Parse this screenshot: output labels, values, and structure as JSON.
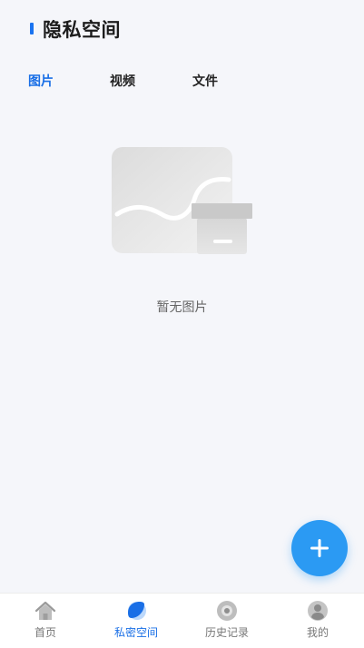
{
  "header": {
    "title": "隐私空间"
  },
  "tabs": [
    {
      "label": "图片",
      "active": true
    },
    {
      "label": "视频",
      "active": false
    },
    {
      "label": "文件",
      "active": false
    }
  ],
  "empty_state": {
    "text": "暂无图片",
    "icon": "empty-box-illustration"
  },
  "fab": {
    "icon": "plus-icon"
  },
  "bottom_nav": [
    {
      "label": "首页",
      "icon": "home-icon",
      "active": false
    },
    {
      "label": "私密空间",
      "icon": "private-space-icon",
      "active": true
    },
    {
      "label": "历史记录",
      "icon": "history-icon",
      "active": false
    },
    {
      "label": "我的",
      "icon": "profile-icon",
      "active": false
    }
  ],
  "colors": {
    "accent": "#1a6fe6",
    "fab": "#2b9af3",
    "background": "#f5f6fa"
  }
}
